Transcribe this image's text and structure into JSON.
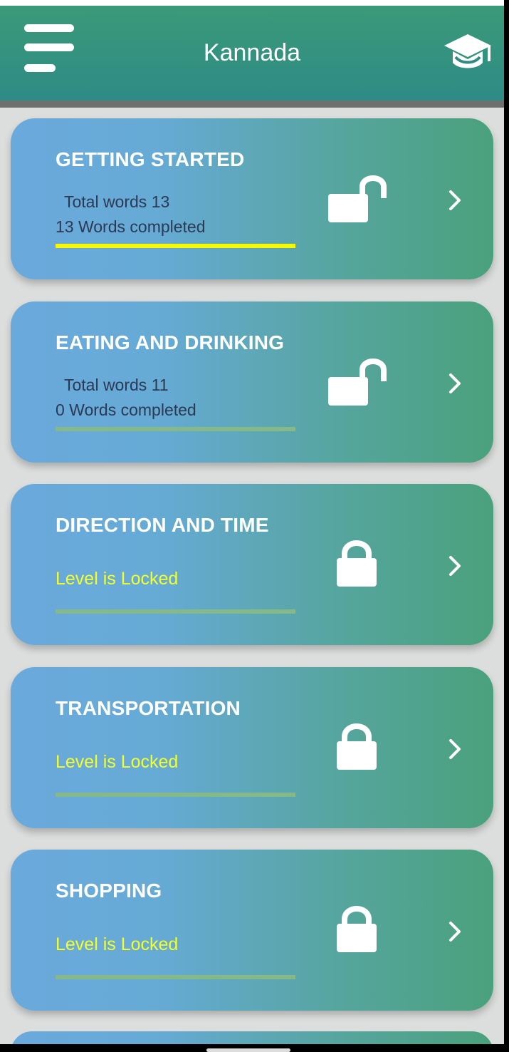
{
  "header": {
    "title": "Kannada",
    "menu_icon": "hamburger-menu-icon",
    "right_icon": "graduation-cap-icon"
  },
  "colors": {
    "appbar": "#34927f",
    "card_start": "#6aa9dc",
    "card_end": "#4aa17c",
    "progress_fill": "#f8f800",
    "locked_text": "#f4ff2a"
  },
  "levels": [
    {
      "title": "GETTING STARTED",
      "total": " Total words 13",
      "completed": "13 Words completed",
      "state": "unlocked",
      "progress": 1.0
    },
    {
      "title": "EATING AND DRINKING",
      "total": " Total words 11",
      "completed": "0 Words completed",
      "state": "unlocked",
      "progress": 0.0
    },
    {
      "title": "DIRECTION AND TIME",
      "locked_text": "Level is Locked",
      "state": "locked",
      "progress": 0.0
    },
    {
      "title": "TRANSPORTATION",
      "locked_text": "Level is Locked",
      "state": "locked",
      "progress": 0.0
    },
    {
      "title": "SHOPPING",
      "locked_text": "Level is Locked",
      "state": "locked",
      "progress": 0.0
    }
  ]
}
